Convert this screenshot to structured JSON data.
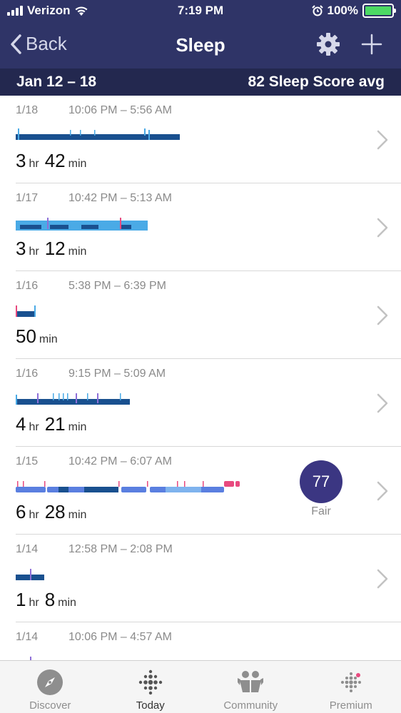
{
  "status": {
    "carrier": "Verizon",
    "time": "7:19 PM",
    "battery": "100%"
  },
  "nav": {
    "back_label": "Back",
    "title": "Sleep"
  },
  "range": {
    "dates": "Jan 12 – 18",
    "avg": "82 Sleep Score avg"
  },
  "colors": {
    "header": "#2f3467",
    "range_bar": "#23284f",
    "deep": "#19508f",
    "light": "#4aaae6",
    "rem": "#5a7fe0",
    "wake": "#e84a7f",
    "score": "#3b3682"
  },
  "entries": [
    {
      "date": "1/18",
      "range": "10:06 PM – 5:56 AM",
      "dur": {
        "h": "3",
        "h_unit": "hr",
        "m": "42",
        "m_unit": "min"
      }
    },
    {
      "date": "1/17",
      "range": "10:42 PM – 5:13 AM",
      "dur": {
        "h": "3",
        "h_unit": "hr",
        "m": "12",
        "m_unit": "min"
      }
    },
    {
      "date": "1/16",
      "range": "5:38 PM – 6:39 PM",
      "dur": {
        "m": "50",
        "m_unit": "min"
      }
    },
    {
      "date": "1/16",
      "range": "9:15 PM – 5:09 AM",
      "dur": {
        "h": "4",
        "h_unit": "hr",
        "m": "21",
        "m_unit": "min"
      }
    },
    {
      "date": "1/15",
      "range": "10:42 PM – 6:07 AM",
      "dur": {
        "h": "6",
        "h_unit": "hr",
        "m": "28",
        "m_unit": "min"
      },
      "score": "77",
      "score_label": "Fair"
    },
    {
      "date": "1/14",
      "range": "12:58 PM – 2:08 PM",
      "dur": {
        "h": "1",
        "h_unit": "hr",
        "m": "8",
        "m_unit": "min"
      }
    },
    {
      "date": "1/14",
      "range": "10:06 PM – 4:57 AM"
    }
  ],
  "tabs": [
    {
      "label": "Discover",
      "icon": "compass-icon"
    },
    {
      "label": "Today",
      "icon": "fitbit-dots-icon",
      "active": true
    },
    {
      "label": "Community",
      "icon": "people-icon"
    },
    {
      "label": "Premium",
      "icon": "fitbit-premium-icon"
    }
  ]
}
